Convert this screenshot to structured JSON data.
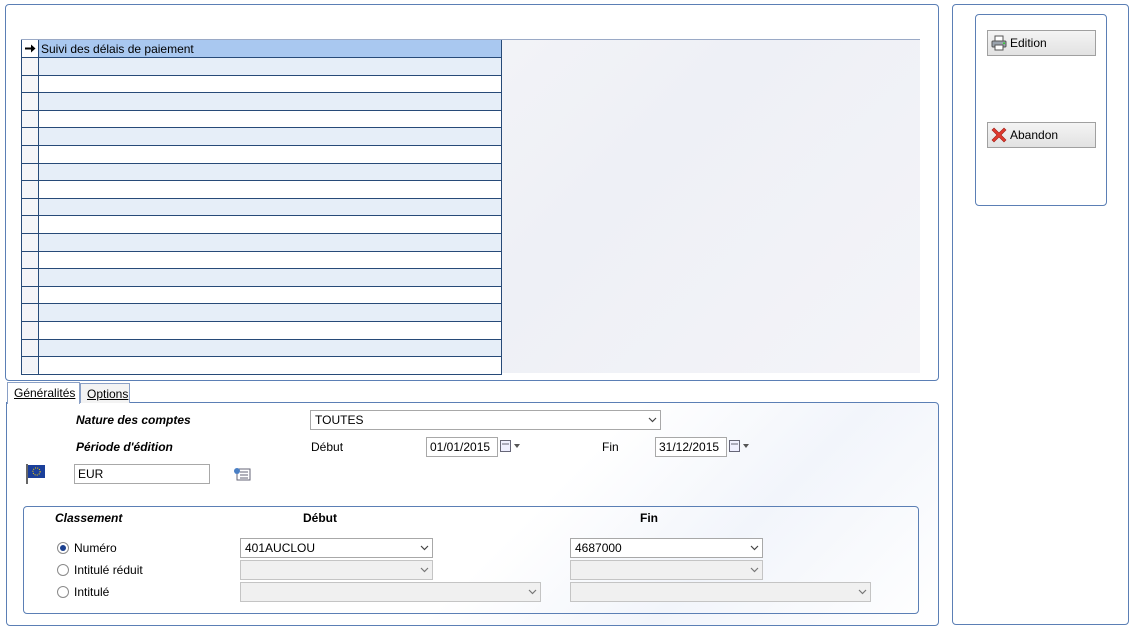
{
  "grid": {
    "rows": [
      "Suivi des délais de paiement",
      "",
      "",
      "",
      "",
      "",
      "",
      "",
      "",
      "",
      "",
      "",
      "",
      "",
      "",
      "",
      "",
      "",
      ""
    ],
    "selected_index": 0
  },
  "buttons": {
    "edition": "Edition",
    "abandon": "Abandon"
  },
  "tabs": {
    "generalites": "Généralités",
    "options": "Options"
  },
  "form": {
    "nature_label": "Nature des comptes",
    "nature_value": "TOUTES",
    "periode_label": "Période d'édition",
    "debut_label": "Début",
    "debut_value": "01/01/2015",
    "fin_label": "Fin",
    "fin_value": "31/12/2015",
    "devise_value": "EUR"
  },
  "classement": {
    "title": "Classement",
    "debut_header": "Début",
    "fin_header": "Fin",
    "options": [
      {
        "label": "Numéro",
        "selected": true,
        "debut": "401AUCLOU",
        "fin": "4687000"
      },
      {
        "label": "Intitulé réduit",
        "selected": false,
        "debut": "",
        "fin": ""
      },
      {
        "label": "Intitulé",
        "selected": false,
        "debut": "",
        "fin": ""
      }
    ]
  },
  "colors": {
    "border": "#5b7fb5",
    "row_alt": "#e6eef8",
    "row_selected": "#a9c8f0",
    "radio_dot": "#1a3f8f"
  }
}
